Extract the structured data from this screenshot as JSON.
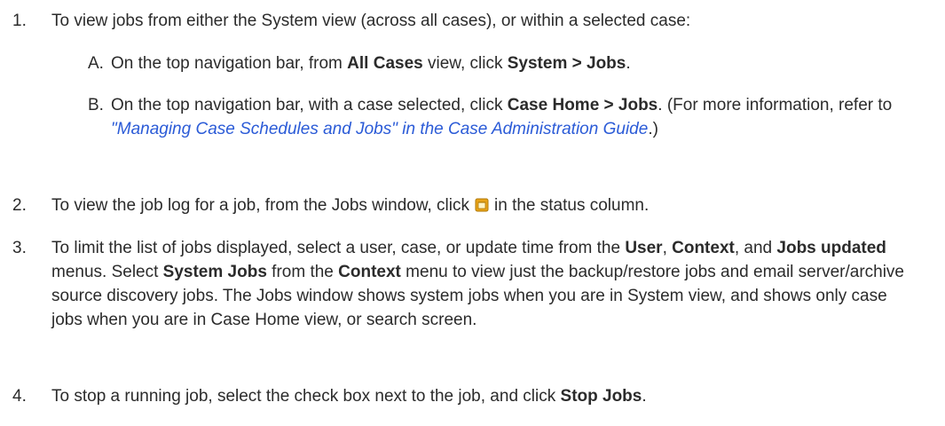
{
  "steps": [
    {
      "num": "1.",
      "text": "To view jobs from either the System view (across all cases), or within a selected case:",
      "subs": [
        {
          "letter": "A.",
          "t1": "On the top navigation bar, from ",
          "b1": "All Cases",
          "t2": " view, click ",
          "b2": "System > Jobs",
          "t3": "."
        },
        {
          "letter": "B.",
          "t1": "On the top navigation bar, with a case selected, click ",
          "b1": "Case Home > Jobs",
          "t2": ". (For more information, refer to ",
          "link": "\"Managing Case Schedules and Jobs\" in the Case Administration Guide",
          "t3": ".)"
        }
      ]
    },
    {
      "num": "2.",
      "t1": "To view the job log for a job, from the Jobs window, click",
      "icon": "job-log-icon",
      "t2": "in the status column."
    },
    {
      "num": "3.",
      "t1": "To limit the list of jobs displayed, select a user, case, or update time from the ",
      "b1": "User",
      "t2": ", ",
      "b2": "Context",
      "t3": ", and ",
      "b3": "Jobs updated",
      "t4": " menus. Select ",
      "b4": "System Jobs",
      "t5": " from the ",
      "b5": "Context",
      "t6": " menu to view just the backup/restore jobs and email server/archive source discovery jobs. The Jobs window shows system jobs when you are in System view, and shows only case jobs when you are in Case Home view, or search screen."
    },
    {
      "num": "4.",
      "t1": "To stop a running job, select the check box next to the job, and click ",
      "b1": "Stop Jobs",
      "t2": "."
    }
  ],
  "colors": {
    "text": "#2b2b2b",
    "link": "#2b5bd7",
    "icon_fill": "#e8a317",
    "icon_border": "#b07a0a"
  }
}
